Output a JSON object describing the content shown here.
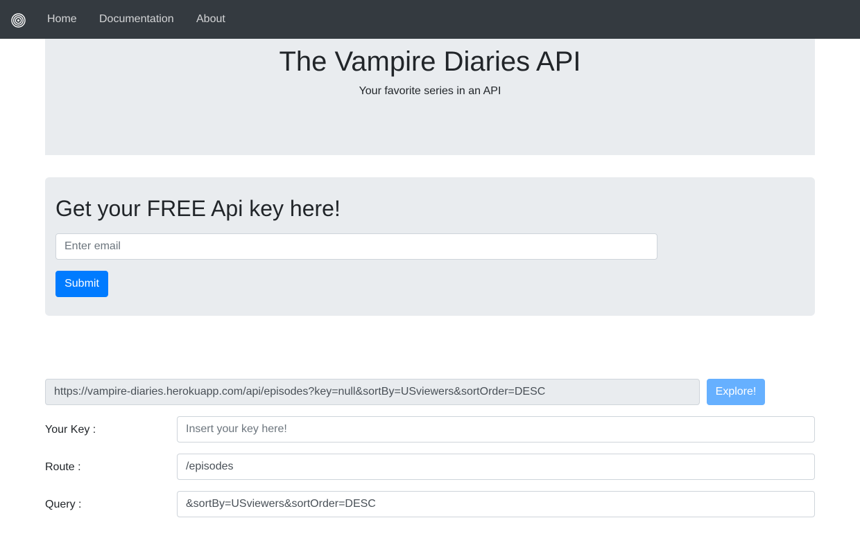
{
  "navbar": {
    "brand_icon": "concentric-circles-logo",
    "links": [
      {
        "label": "Home"
      },
      {
        "label": "Documentation"
      },
      {
        "label": "About"
      }
    ]
  },
  "hero": {
    "title": "The Vampire Diaries API",
    "subtitle": "Your favorite series in an API"
  },
  "signup": {
    "heading": "Get your FREE Api key here!",
    "email_placeholder": "Enter email",
    "submit_label": "Submit"
  },
  "explorer": {
    "url_value": "https://vampire-diaries.herokuapp.com/api/episodes?key=null&sortBy=USviewers&sortOrder=DESC",
    "explore_label": "Explore!",
    "key_label": "Your Key :",
    "key_placeholder": "Insert your key here!",
    "route_label": "Route :",
    "route_value": "/episodes",
    "query_label": "Query :",
    "query_value": "&sortBy=USviewers&sortOrder=DESC"
  },
  "colors": {
    "navbar_bg": "#343a40",
    "panel_bg": "#e9ecef",
    "primary": "#007bff",
    "primary_disabled": "#66b0ff"
  }
}
